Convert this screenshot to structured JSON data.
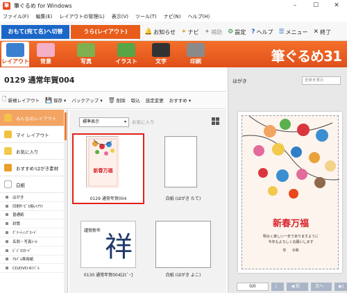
{
  "window": {
    "title": "筆ぐるめ for Windows",
    "icon_letter": "筆"
  },
  "window_controls": {
    "minimize": "–",
    "maximize": "☐",
    "close": "✕"
  },
  "menu": [
    "ファイル(F)",
    "編集(E)",
    "レイアウトの管理(L)",
    "表示(V)",
    "ツール(T)",
    "ナビ(N)",
    "ヘルプ(H)"
  ],
  "mode_tabs": {
    "omote": "おもて(宛て名)へ切替",
    "ura": "うら(レイアウト)"
  },
  "top_actions": [
    {
      "icon": "🔔",
      "label": "お知らせ",
      "name": "news"
    },
    {
      "icon": "✦",
      "label": "ナビ",
      "name": "navi"
    },
    {
      "icon": "✦",
      "label": "補助",
      "name": "assist"
    },
    {
      "icon": "⚙",
      "label": "設定",
      "name": "settings"
    },
    {
      "icon": "?",
      "label": "ヘルプ",
      "name": "help"
    },
    {
      "icon": "☰",
      "label": "メニュー",
      "name": "menu"
    },
    {
      "icon": "✕",
      "label": "終了",
      "name": "exit"
    }
  ],
  "ribbon": {
    "tabs": [
      {
        "label": "レイアウト",
        "color": "#3b7fd0",
        "active": true
      },
      {
        "label": "背景",
        "color": "#f3b0c8"
      },
      {
        "label": "写真",
        "color": "#7fb04e"
      },
      {
        "label": "イラスト",
        "color": "#58a548"
      },
      {
        "label": "文字",
        "color": "#333333"
      },
      {
        "label": "印刷",
        "color": "#8a8a8a"
      }
    ],
    "brand": "筆ぐるめ31"
  },
  "document": {
    "title": "0129 通常年賀004"
  },
  "commands": [
    {
      "icon": "🗋",
      "label": "新規レイアウト"
    },
    {
      "icon": "💾",
      "label": "保存 ▾"
    },
    {
      "icon": "",
      "label": "バックアップ ▾"
    },
    {
      "icon": "🗑",
      "label": "削除"
    },
    {
      "icon": "",
      "label": "取込"
    },
    {
      "icon": "",
      "label": "設定変更"
    },
    {
      "icon": "",
      "label": "おすすめ ▾"
    }
  ],
  "sidebar": {
    "categories": [
      {
        "label": "みんなのレイアウト",
        "active": true,
        "color": "#f5c24a"
      },
      {
        "label": "マイ レイアウト",
        "color": "#f0c040"
      },
      {
        "label": "お気に入り",
        "color": "#f2c94c"
      },
      {
        "label": "おすすめ!はがき素材",
        "color": "#e8a02a"
      },
      {
        "label": "白紙",
        "color": "#dddddd"
      }
    ],
    "subitems": [
      "はがき",
      "印刷ｻｰﾋﾞｽ用ﾚｲｱｳﾄ",
      "普通紙",
      "封筒",
      "ｸﾞﾘｰﾃｨﾝｸﾞｶｰﾄﾞ",
      "名刺・写真ｼｰﾙ",
      "ﾋﾞｼﾞﾈｽｶｰﾄﾞ",
      "ｱﾙﾊﾞﾑ専用紙",
      "CD/DVD-Rﾗﾍﾞﾙ"
    ]
  },
  "content": {
    "filter_value": "標準表示",
    "filter_arrow": "▾",
    "favorites_label": "お気に入り",
    "cards": [
      {
        "caption": "0129 通常年賀004",
        "kind": "nenga",
        "selected": true,
        "card_text": "新春万福"
      },
      {
        "caption": "白紙 (はがき たて)",
        "kind": "blank"
      },
      {
        "caption": "0130 通常年賀004[2ﾋﾞｰ]",
        "kind": "kanji",
        "card_text_1": "謹賀新年",
        "card_text_2": "祥"
      },
      {
        "caption": "白紙 (はがき よこ)",
        "kind": "blank"
      }
    ]
  },
  "preview": {
    "label": "はがき",
    "select_value": "全体を表示",
    "main_text": "新春万福",
    "message_line1": "明るく楽しい一年でありますように",
    "message_line2": "今年もよろしくお願いします",
    "date_line": "年 　 令和",
    "page_count": "0/0",
    "prev_label": "◀ 前へ",
    "next_label": "次へ ▶",
    "first_label": "|◀",
    "last_label": "▶|"
  },
  "colors": {
    "accent_orange": "#e85d1b",
    "accent_blue": "#1b67c8",
    "select_red": "#e0201a"
  }
}
